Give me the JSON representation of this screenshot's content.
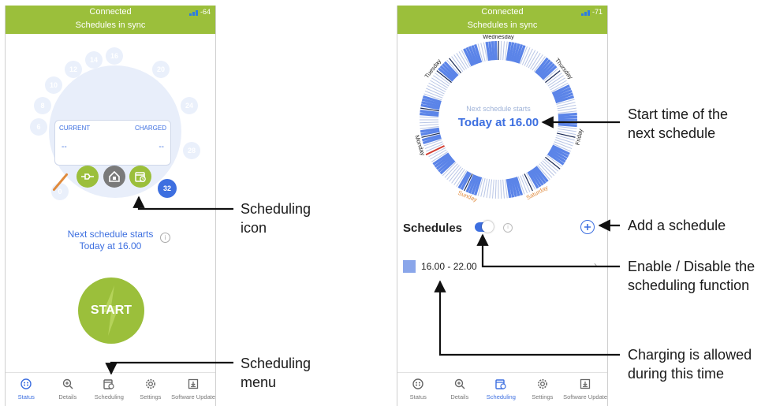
{
  "left_phone": {
    "status": {
      "line1": "Connected",
      "line2": "Schedules in sync",
      "signal": "-64"
    },
    "dial_numbers": [
      "16",
      "14",
      "12",
      "10",
      "8",
      "6",
      "20",
      "24",
      "28",
      "0"
    ],
    "card": {
      "current_label": "CURRENT",
      "charged_label": "CHARGED",
      "current_value": "--",
      "charged_value": "--"
    },
    "badge": "32",
    "next_schedule": {
      "line1": "Next schedule starts",
      "line2": "Today at 16.00"
    },
    "start_label": "START",
    "tabs": [
      "Status",
      "Details",
      "Scheduling",
      "Settings",
      "Software Update"
    ]
  },
  "right_phone": {
    "status": {
      "line1": "Connected",
      "line2": "Schedules in sync",
      "signal": "-71"
    },
    "days": [
      "Wednesday",
      "Thursday",
      "Friday",
      "Saturday",
      "Sunday",
      "Monday",
      "Tuesday"
    ],
    "center": {
      "line1": "Next schedule starts",
      "line2": "Today at 16.00"
    },
    "schedules_title": "Schedules",
    "schedule_item": "16.00 - 22.00",
    "tabs": [
      "Status",
      "Details",
      "Scheduling",
      "Settings",
      "Software Update"
    ]
  },
  "annotations": {
    "scheduling_icon": [
      "Scheduling",
      "icon"
    ],
    "scheduling_menu": [
      "Scheduling",
      "menu"
    ],
    "start_time": [
      "Start time of the",
      "next schedule"
    ],
    "add_schedule": "Add a schedule",
    "enable_disable": [
      "Enable / Disable the",
      "scheduling function"
    ],
    "charging_allowed": [
      "Charging is allowed",
      "during this time"
    ]
  },
  "colors": {
    "green": "#9bbf3b",
    "blue": "#3d6fe0",
    "dial_bg": "#e8eefa",
    "orange": "#e08a3c"
  }
}
